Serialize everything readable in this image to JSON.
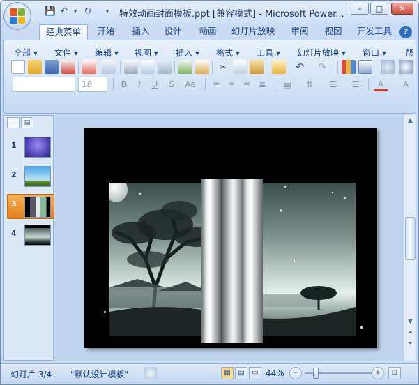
{
  "window": {
    "title": "特效动画封面模板.ppt [兼容模式] - Microsoft Power...",
    "minimize": "–",
    "maximize": "□",
    "close": "✕"
  },
  "quick_access": {
    "save": "💾",
    "undo": "↶",
    "undo_dropdown": "▾",
    "redo": "↻",
    "customize": "▾"
  },
  "tabs": [
    {
      "label": "经典菜单"
    },
    {
      "label": "开始"
    },
    {
      "label": "插入"
    },
    {
      "label": "设计"
    },
    {
      "label": "动画"
    },
    {
      "label": "幻灯片放映"
    },
    {
      "label": "审阅"
    },
    {
      "label": "视图"
    },
    {
      "label": "开发工具"
    }
  ],
  "help": "?",
  "menubar": [
    {
      "label": "全部 ▾"
    },
    {
      "label": "文件 ▾"
    },
    {
      "label": "编辑 ▾"
    },
    {
      "label": "视图 ▾"
    },
    {
      "label": "插入 ▾"
    },
    {
      "label": "格式 ▾"
    },
    {
      "label": "工具 ▾"
    },
    {
      "label": "幻灯片放映 ▾"
    },
    {
      "label": "窗口 ▾"
    },
    {
      "label": "帮"
    }
  ],
  "font": {
    "name": "",
    "size": "18"
  },
  "format_buttons": {
    "bold": "B",
    "italic": "I",
    "underline": "U",
    "shadow": "S",
    "change_case": "Aa"
  },
  "slides_panel": {
    "outline_tab": "▤",
    "slides": [
      {
        "num": "1"
      },
      {
        "num": "2"
      },
      {
        "num": "3"
      },
      {
        "num": "4"
      }
    ],
    "selected": "3"
  },
  "status": {
    "slide": "幻灯片 3/4",
    "theme": "\"默认设计模板\"",
    "zoom": "44%",
    "zoom_minus": "–",
    "zoom_plus": "+"
  },
  "colors": {
    "ribbon_bg": "#d3e3f5",
    "accent": "#15428b",
    "selected_slide": "#e17d1a",
    "workspace": "#bfd3ec"
  }
}
